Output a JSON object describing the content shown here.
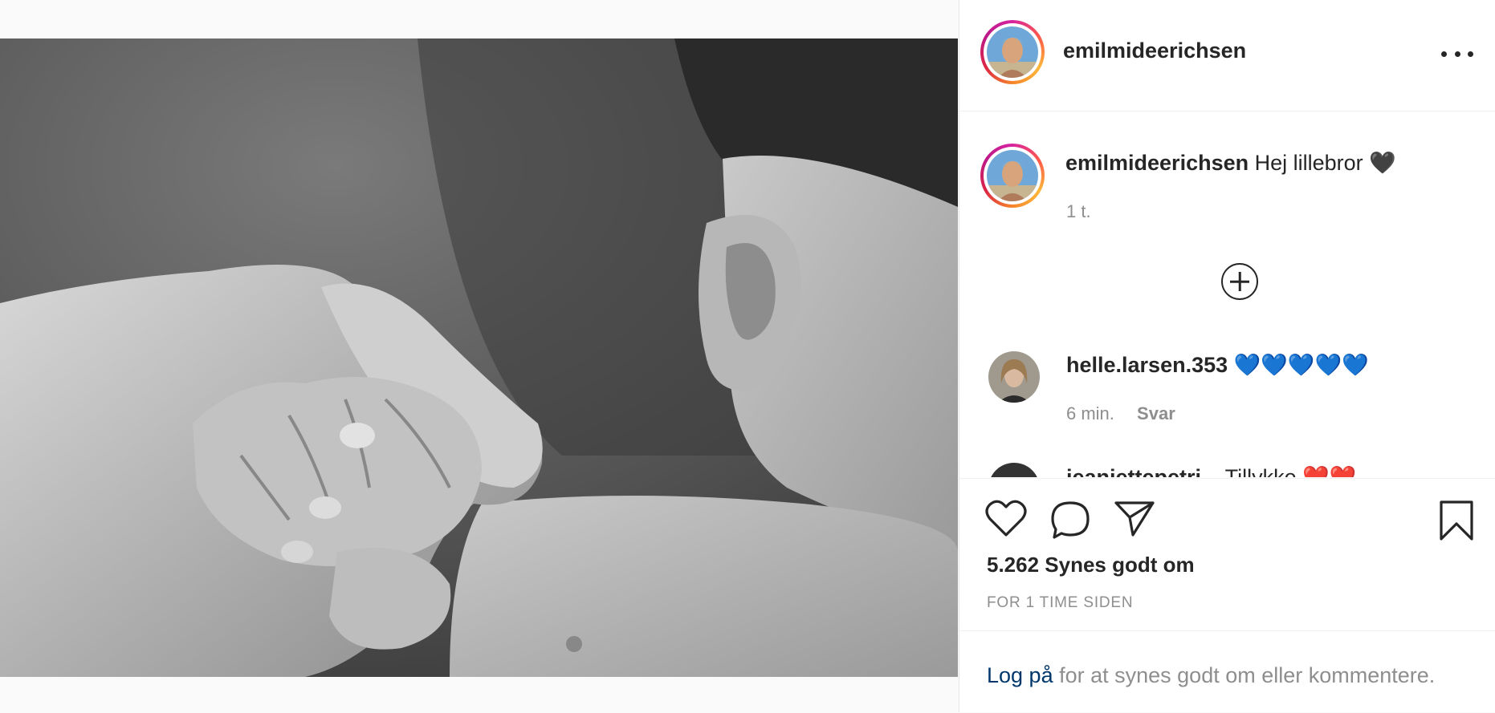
{
  "post": {
    "username": "emilmideerichsen",
    "more_icon": "more-dots-icon"
  },
  "caption": {
    "username": "emilmideerichsen",
    "text": "Hej lillebror",
    "emoji": "🖤",
    "time": "1 t."
  },
  "load_more_icon": "plus-circle-icon",
  "comments": [
    {
      "username": "helle.larsen.353",
      "text": "💙💙💙💙💙",
      "time": "6 min.",
      "reply_label": "Svar"
    },
    {
      "username": "jeanjettepetri...",
      "text": "Tillykke ❤️❤️",
      "time": "",
      "reply_label": ""
    }
  ],
  "actions": {
    "like_icon": "heart-icon",
    "comment_icon": "speech-bubble-icon",
    "share_icon": "paper-plane-icon",
    "save_icon": "bookmark-icon"
  },
  "likes_text": "5.262 Synes godt om",
  "timestamp": "FOR 1 TIME SIDEN",
  "login": {
    "link": "Log på",
    "rest": " for at synes godt om eller kommentere."
  },
  "colors": {
    "accent_link": "#00376b",
    "muted": "#8e8e8e",
    "text": "#262626",
    "reaction_blue": "#1e6fff"
  }
}
